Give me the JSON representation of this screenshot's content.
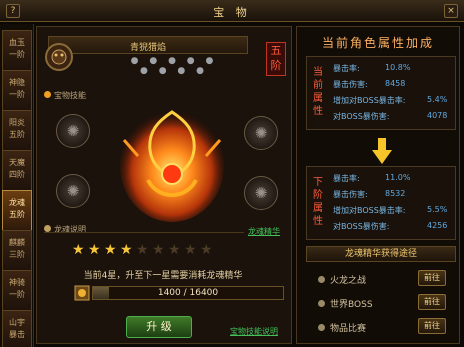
{
  "window": {
    "title": "宝 物",
    "help": "?",
    "close": "×"
  },
  "sidebar": {
    "tabs": [
      {
        "label": "血玉\n一阶",
        "active": false
      },
      {
        "label": "神隐\n一阶",
        "active": false
      },
      {
        "label": "阳炎\n五阶",
        "active": false
      },
      {
        "label": "天魔\n四阶",
        "active": false
      },
      {
        "label": "龙魂\n五阶",
        "active": true
      },
      {
        "label": "麒麟\n三阶",
        "active": false
      },
      {
        "label": "神骑\n一阶",
        "active": false
      },
      {
        "label": "山宇\n暴击",
        "active": false
      }
    ]
  },
  "item": {
    "name": "青猊猎焰",
    "grade": "五\n阶"
  },
  "left": {
    "skill_label": "宝物技能",
    "dragon_label": "龙魂说明",
    "top_link": "龙魂精华",
    "bottom_link": "宝物技能说明"
  },
  "star": {
    "count": 4,
    "total": 9
  },
  "upgrade": {
    "desc": "当前4星，升至下一星需要消耗龙魂精华",
    "current": 1400,
    "max": 16400,
    "progress_text": "1400 / 16400",
    "button": "升 级"
  },
  "right": {
    "title": "当前角色属性加成",
    "current_label": "当前属性",
    "next_label": "下阶属性",
    "current": [
      {
        "name": "暴击率:",
        "value": "10.8%"
      },
      {
        "name": "暴击伤害:",
        "value": "8458"
      },
      {
        "name": "增加对BOSS暴击率:",
        "value": "5.4%"
      },
      {
        "name": "对BOSS暴伤害:",
        "value": "4078"
      }
    ],
    "next": [
      {
        "name": "暴击率:",
        "value": "11.0%"
      },
      {
        "name": "暴击伤害:",
        "value": "8532"
      },
      {
        "name": "增加对BOSS暴击率:",
        "value": "5.5%"
      },
      {
        "name": "对BOSS暴伤害:",
        "value": "4256"
      }
    ],
    "source_title": "龙魂精华获得途径",
    "sources": [
      {
        "name": "火龙之战",
        "button": "前往"
      },
      {
        "name": "世界BOSS",
        "button": "前往"
      },
      {
        "name": "物品比赛",
        "button": "前往"
      }
    ]
  }
}
